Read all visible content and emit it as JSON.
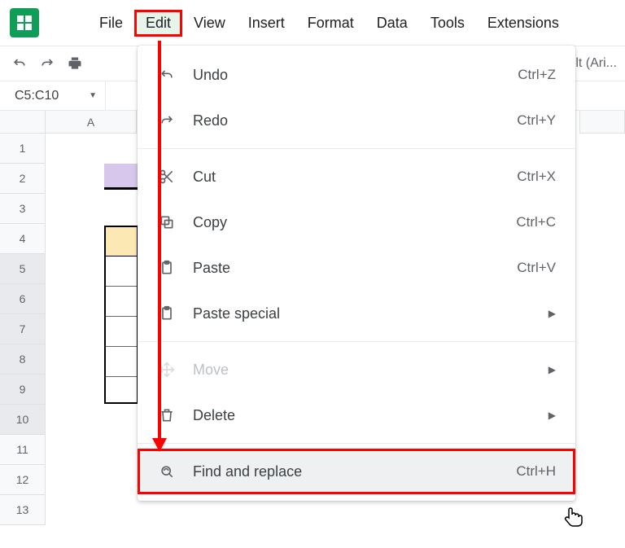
{
  "menubar": {
    "file": "File",
    "edit": "Edit",
    "view": "View",
    "insert": "Insert",
    "format": "Format",
    "data": "Data",
    "tools": "Tools",
    "extensions": "Extensions"
  },
  "toolbar": {
    "font_display": "ult (Ari..."
  },
  "namebox": {
    "value": "C5:C10"
  },
  "columns": {
    "A": "A"
  },
  "rows": [
    "1",
    "2",
    "3",
    "4",
    "5",
    "6",
    "7",
    "8",
    "9",
    "10",
    "11",
    "12",
    "13"
  ],
  "edit_menu": {
    "undo": {
      "label": "Undo",
      "shortcut": "Ctrl+Z"
    },
    "redo": {
      "label": "Redo",
      "shortcut": "Ctrl+Y"
    },
    "cut": {
      "label": "Cut",
      "shortcut": "Ctrl+X"
    },
    "copy": {
      "label": "Copy",
      "shortcut": "Ctrl+C"
    },
    "paste": {
      "label": "Paste",
      "shortcut": "Ctrl+V"
    },
    "paste_special": {
      "label": "Paste special"
    },
    "move": {
      "label": "Move"
    },
    "delete": {
      "label": "Delete"
    },
    "find_replace": {
      "label": "Find and replace",
      "shortcut": "Ctrl+H"
    }
  }
}
